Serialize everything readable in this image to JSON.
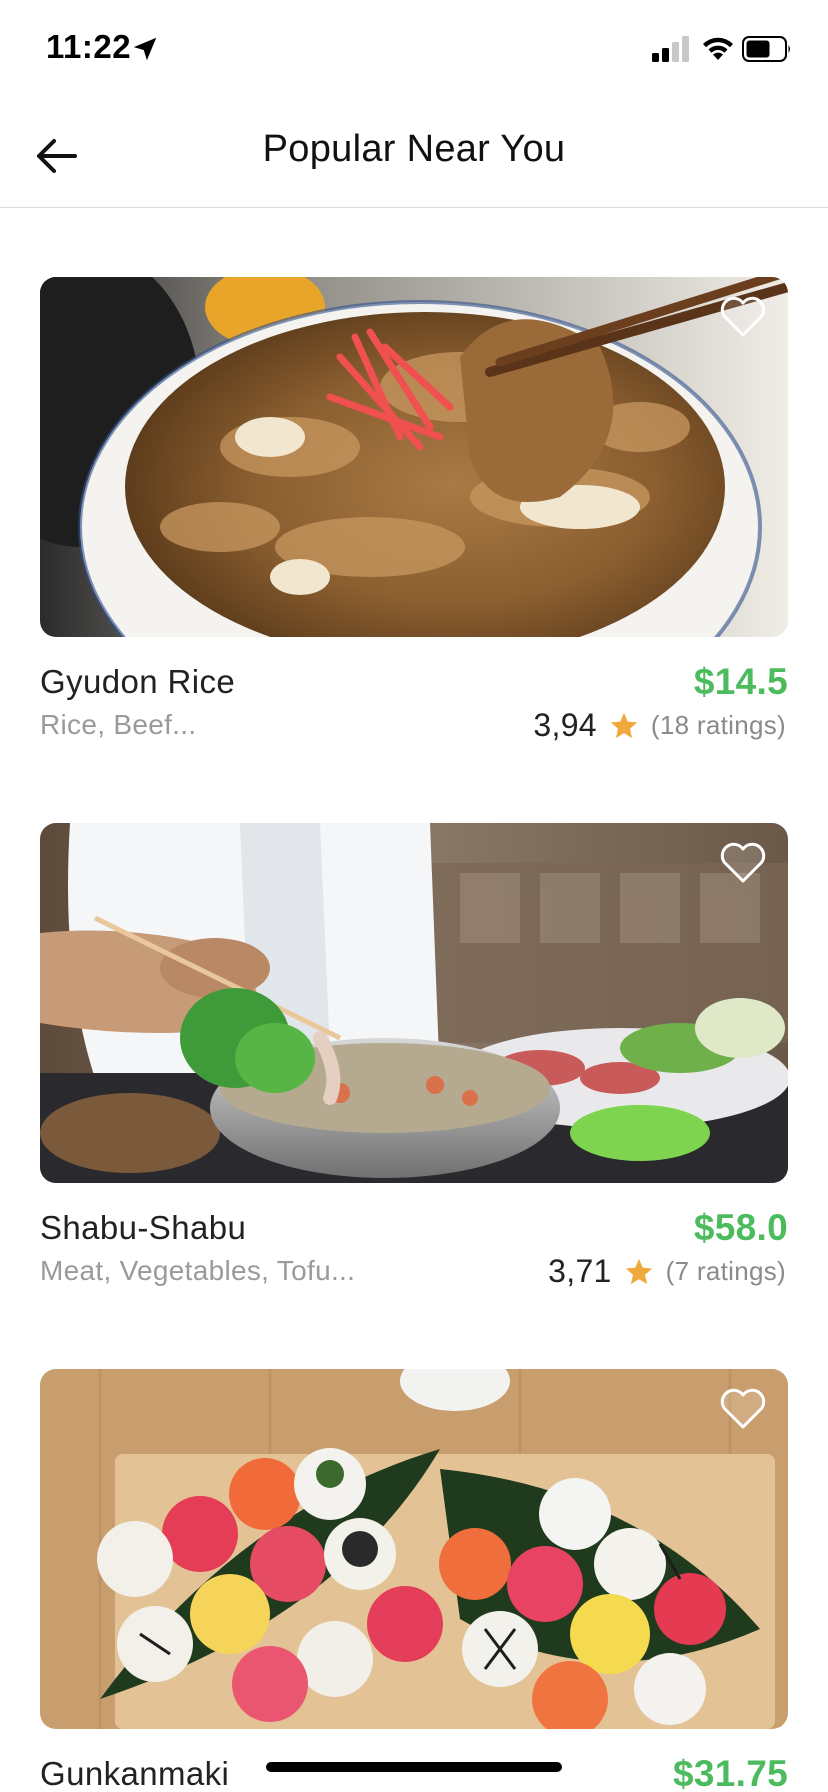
{
  "status_bar": {
    "time": "11:22",
    "icons": [
      "location-arrow-icon",
      "cellular-signal-icon",
      "wifi-icon",
      "battery-icon"
    ]
  },
  "nav": {
    "title": "Popular Near You",
    "back_icon": "back-arrow-icon"
  },
  "colors": {
    "price": "#4cbb5e",
    "star": "#f0a93c",
    "subtext": "#9a9a9a",
    "divider": "#dcdcdc"
  },
  "dishes": [
    {
      "name": "Gyudon Rice",
      "tags": "Rice, Beef...",
      "price": "$14.5",
      "rating": "3,94",
      "ratings_count": "(18 ratings)",
      "favorite_icon": "heart-outline-icon"
    },
    {
      "name": "Shabu-Shabu",
      "tags": "Meat, Vegetables, Tofu...",
      "price": "$58.0",
      "rating": "3,71",
      "ratings_count": "(7 ratings)",
      "favorite_icon": "heart-outline-icon"
    },
    {
      "name": "Gunkanmaki",
      "price": "$31.75",
      "favorite_icon": "heart-outline-icon"
    }
  ]
}
